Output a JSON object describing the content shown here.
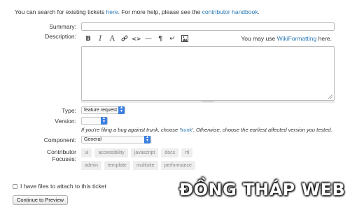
{
  "intro": {
    "prefix": "You can search for existing tickets ",
    "here_link": "here",
    "middle": ". For more help, please see the ",
    "handbook_link": "contributor handbook",
    "suffix": "."
  },
  "form": {
    "summary_label": "Summary:",
    "summary_value": "",
    "description_label": "Description:",
    "description_value": "",
    "toolbar_icons": [
      "bold-icon",
      "italic-icon",
      "heading-icon",
      "link-icon",
      "code-icon",
      "horizontal-rule-icon",
      "paragraph-icon",
      "line-break-icon",
      "image-icon"
    ],
    "toolbar": {
      "bold": "B",
      "italic": "I",
      "heading": "A",
      "code": "<>",
      "hr": "—",
      "paragraph": "¶",
      "linebreak": "↵"
    },
    "wiki_prefix": "You may use ",
    "wiki_link": "WikiFormatting",
    "wiki_suffix": " here.",
    "type_label": "Type:",
    "type_value": "feature request",
    "version_label": "Version:",
    "version_value": "",
    "version_hint_prefix": "If you're filing a bug against trunk, choose '",
    "version_hint_link": "trunk",
    "version_hint_suffix": "'. Otherwise, choose the earliest affected version you tested.",
    "component_label": "Component:",
    "component_value": "General",
    "focuses_label_line1": "Contributor",
    "focuses_label_line2": "Focuses:",
    "focuses_row1": [
      "ui",
      "accessibility",
      "javascript",
      "docs",
      "rtl"
    ],
    "focuses_row2": [
      "admin",
      "template",
      "multisite",
      "performance"
    ],
    "attach_label": "I have files to attach to this ticket",
    "attach_checked": false,
    "preview_button": "Continue to Preview"
  },
  "watermark": "ĐỒNG THÁP WEB",
  "colors": {
    "link": "#2a7ab8",
    "select_arrow": "#3b7fe0",
    "tag_bg": "#eeeeee"
  }
}
